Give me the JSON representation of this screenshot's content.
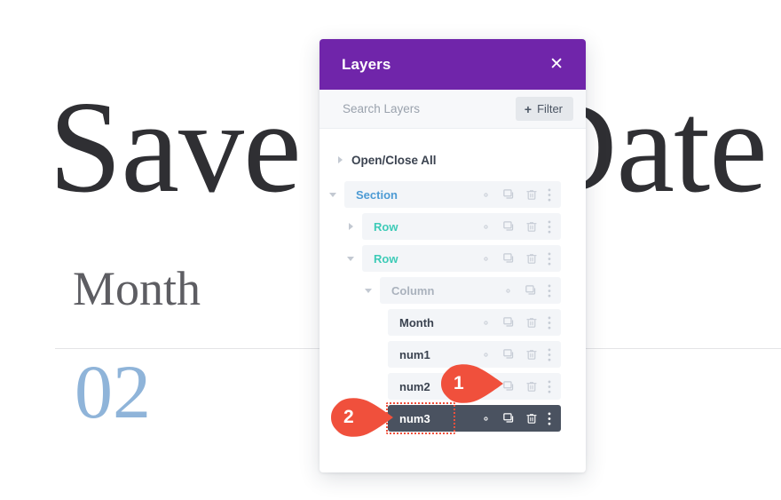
{
  "background": {
    "headline": "Save the Date",
    "month_label": "Month",
    "day_number": "02"
  },
  "panel": {
    "title": "Layers",
    "close_icon": "close-icon",
    "search": {
      "placeholder": "Search Layers",
      "value": ""
    },
    "filter_button": {
      "plus": "+",
      "label": "Filter"
    },
    "open_close_all": "Open/Close All",
    "colors": {
      "header_purple": "#7025aa",
      "section_blue": "#4d9bd4",
      "row_teal": "#3ecbb7",
      "column_gray": "#aab2bd",
      "module_dark": "#3b4350",
      "selected_row_bg": "#4a5260",
      "marker_red": "#f0503c",
      "filter_button_bg": "#e5e8ec",
      "row_bg": "#f3f5f8"
    },
    "layers": [
      {
        "label": "Section",
        "level": "section",
        "color_class": "c-section",
        "toggle": "down",
        "selected": false,
        "actions": [
          "gear-icon",
          "duplicate-icon",
          "trash-icon",
          "more-icon"
        ]
      },
      {
        "label": "Row",
        "level": "row",
        "color_class": "c-row",
        "toggle": "right",
        "selected": false,
        "actions": [
          "gear-icon",
          "duplicate-icon",
          "trash-icon",
          "more-icon"
        ]
      },
      {
        "label": "Row",
        "level": "row",
        "color_class": "c-row",
        "toggle": "down",
        "selected": false,
        "actions": [
          "gear-icon",
          "duplicate-icon",
          "trash-icon",
          "more-icon"
        ]
      },
      {
        "label": "Column",
        "level": "col",
        "color_class": "c-column",
        "toggle": "down",
        "selected": false,
        "actions": [
          "gear-icon",
          "duplicate-icon",
          "more-icon"
        ]
      },
      {
        "label": "Month",
        "level": "mod",
        "color_class": "c-module",
        "toggle": "none",
        "selected": false,
        "actions": [
          "gear-icon",
          "duplicate-icon",
          "trash-icon",
          "more-icon"
        ]
      },
      {
        "label": "num1",
        "level": "mod",
        "color_class": "c-module",
        "toggle": "none",
        "selected": false,
        "actions": [
          "gear-icon",
          "duplicate-icon",
          "trash-icon",
          "more-icon"
        ]
      },
      {
        "label": "num2",
        "level": "mod",
        "color_class": "c-module",
        "toggle": "none",
        "selected": false,
        "actions": [
          "gear-icon",
          "duplicate-icon",
          "trash-icon",
          "more-icon"
        ]
      },
      {
        "label": "num3",
        "level": "mod",
        "color_class": "c-module",
        "toggle": "none",
        "selected": true,
        "actions": [
          "gear-icon",
          "duplicate-icon",
          "trash-icon",
          "more-icon"
        ]
      }
    ]
  },
  "markers": [
    {
      "number": "1"
    },
    {
      "number": "2"
    }
  ]
}
